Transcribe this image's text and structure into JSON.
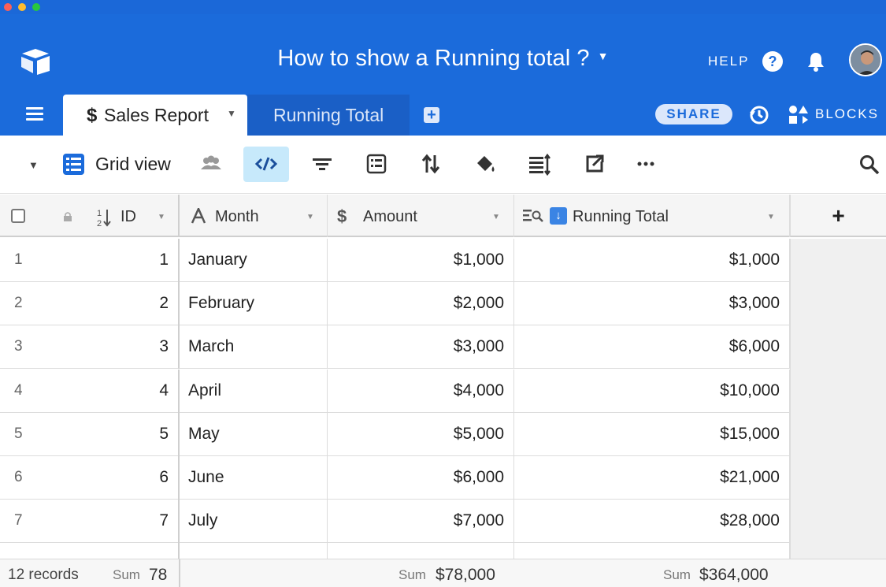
{
  "app": {
    "base_title": "How to show a Running total ?",
    "help_label": "HELP",
    "share_label": "SHARE",
    "blocks_label": "BLOCKS",
    "brand_color": "#1b6bdb"
  },
  "tabs": [
    {
      "icon": "$",
      "label": "Sales Report",
      "active": true
    },
    {
      "label": "Running Total",
      "active": false
    }
  ],
  "view": {
    "name": "Grid view",
    "toolbar_icons": [
      "collaborators-icon",
      "code-icon",
      "filter-icon",
      "group-icon",
      "sort-icon",
      "color-icon",
      "row-height-icon",
      "share-view-icon",
      "more-icon"
    ]
  },
  "columns": [
    {
      "name": "ID",
      "type": "autonumber"
    },
    {
      "name": "Month",
      "type": "text"
    },
    {
      "name": "Amount",
      "type": "currency"
    },
    {
      "name": "Running Total",
      "type": "lookup",
      "emoji": "⬇️"
    }
  ],
  "rows": [
    {
      "n": "1",
      "id": "1",
      "month": "January",
      "amount": "$1,000",
      "running": "$1,000"
    },
    {
      "n": "2",
      "id": "2",
      "month": "February",
      "amount": "$2,000",
      "running": "$3,000"
    },
    {
      "n": "3",
      "id": "3",
      "month": "March",
      "amount": "$3,000",
      "running": "$6,000"
    },
    {
      "n": "4",
      "id": "4",
      "month": "April",
      "amount": "$4,000",
      "running": "$10,000"
    },
    {
      "n": "5",
      "id": "5",
      "month": "May",
      "amount": "$5,000",
      "running": "$15,000"
    },
    {
      "n": "6",
      "id": "6",
      "month": "June",
      "amount": "$6,000",
      "running": "$21,000"
    },
    {
      "n": "7",
      "id": "7",
      "month": "July",
      "amount": "$7,000",
      "running": "$28,000"
    }
  ],
  "footer": {
    "records": "12 records",
    "sum_label": "Sum",
    "id_sum": "78",
    "amount_sum": "$78,000",
    "running_sum": "$364,000"
  }
}
